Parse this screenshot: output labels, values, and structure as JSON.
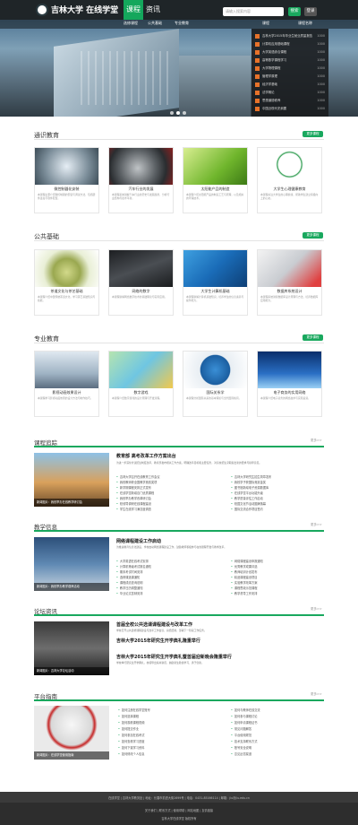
{
  "header": {
    "logo_text": "吉林大学 在线学堂",
    "tabs": [
      "课程",
      "资讯"
    ],
    "search_placeholder": "请输入搜索内容",
    "search_btn": "搜索",
    "login_btn": "登录"
  },
  "hero": {
    "subnav": [
      "选修课程",
      "公共基础",
      "专业教育",
      "课程",
      "课程名称"
    ],
    "popup_items": [
      {
        "label": "吉林大学2015年毕业生就业质量报告",
        "count": "1000"
      },
      {
        "label": "计算机应用基础课程",
        "count": "1000"
      },
      {
        "label": "大学英语综合课程",
        "count": "1000"
      },
      {
        "label": "高等数学课程学习",
        "count": "1000"
      },
      {
        "label": "大学物理课程",
        "count": "1000"
      },
      {
        "label": "管理学原理",
        "count": "1000"
      },
      {
        "label": "经济学基础",
        "count": "1000"
      },
      {
        "label": "法学概论",
        "count": "1000"
      },
      {
        "label": "思想道德修养",
        "count": "1000"
      },
      {
        "label": "中国近现代史纲要",
        "count": "1000"
      }
    ]
  },
  "sections": [
    {
      "title": "通识教育",
      "more": "更多课程",
      "cards": [
        {
          "title": "微控制器化安装",
          "desc": "本课程主要介绍微控制器的安装与调试方法，包括硬件连接与软件配置。"
        },
        {
          "title": "汽车行业的发展",
          "desc": "本课程系统讲解汽车行业的历史与发展趋势，分析行业结构与技术革新。"
        },
        {
          "title": "太阳能产品的制造",
          "desc": "本课程介绍太阳能产品的制造工艺与原理，以及相关的环保技术。"
        },
        {
          "title": "大学生心理健康教育",
          "desc": "本课程关注大学生的心理健康，帮助学生建立积极向上的心态。"
        }
      ]
    },
    {
      "title": "公共基础",
      "more": "更多课程",
      "cards": [
        {
          "title": "茶道文化与茶艺基础",
          "desc": "本课程介绍中国传统茶道文化，学习茶艺基础知识与技能。"
        },
        {
          "title": "网络的数字",
          "desc": "本课程讲解网络数字技术的基础理论与实际应用。"
        },
        {
          "title": "大学生计算机基础",
          "desc": "本课程讲解计算机基础知识，培养学生的信息素养与操作能力。"
        },
        {
          "title": "数据库系统设计",
          "desc": "本课程系统讲授数据库设计原理与方法，培养数据库应用能力。"
        }
      ]
    },
    {
      "title": "专业教育",
      "more": "更多课程",
      "cards": [
        {
          "title": "影视动画效果设计",
          "desc": "本课程学习影视动画效果的设计方法与制作技巧。"
        },
        {
          "title": "数字游戏",
          "desc": "本课程介绍数字游戏的设计原理与开发流程。"
        },
        {
          "title": "国际关系学",
          "desc": "本课程分析国际关系的基本理论与当代国际格局。"
        },
        {
          "title": "电子商务的实用网络",
          "desc": "本课程介绍电子商务的网络技术与实际运营。"
        }
      ]
    }
  ],
  "news": [
    {
      "title": "课程追踪",
      "more": "更多>>",
      "caption": "新闻图片：我校举办在线教学研讨会",
      "headline": "教育部 高考改革工作方案出台",
      "summary": "为进一步深化考试招生制度改革，教育部发布相关工作方案，明确改革目标和主要任务，对高校招生录取提出新的要求与指导意见。",
      "left_items": [
        "吉林大学召开在线教育工作会议",
        "我校教师获全国教学竞赛奖项",
        "新学期课程安排正式发布",
        "在线学堂新增百门优质课程",
        "我校举办教学改革研讨会",
        "校领导调研在线课程建设",
        "学生在线学习满意度调查"
      ],
      "right_items": [
        "吉林大学研究生招生简章发布",
        "我校学子获国际竞赛金奖",
        "图书馆新增电子资源数据库",
        "在线学堂平台功能升级",
        "教学质量评估工作启动",
        "校园文化节活动圆满落幕",
        "国际交流合作项目签约"
      ]
    },
    {
      "title": "教学信息",
      "more": "更多>>",
      "caption": "新闻图片：我校举办教学观摩活动",
      "headline": "网络课程建设工作启动",
      "summary": "为推进教育信息化建设，学校启动网络课程建设工作，鼓励教师积极参与在线课程开发与教学改革。",
      "left_items": [
        "大学英语在线考试安排",
        "计算机等级考试报名通知",
        "期末考试时间安排",
        "选修课选课通知",
        "课程成绩查询说明",
        "教学日历调整通知",
        "毕业论文答辩安排"
      ],
      "right_items": [
        "网络课程建设申报通知",
        "优秀教学成果评选",
        "教师培训计划发布",
        "精品课程建设项目",
        "实验教学改革方案",
        "课程思政示范课程",
        "教学督导工作安排"
      ]
    },
    {
      "title": "论坛资讯",
      "more": "更多>>",
      "caption": "新闻图片：吉林大学论坛活动",
      "headline": "首届全校公共选课课程建设与改革工作",
      "headline2": "吉林大学2015年研究生开学典礼隆重举行",
      "headline3": "吉林大学2015年研究生开学典礼暨首届迎新晚会隆重举行",
      "summary": "学校召开公共选修课程建设与改革工作会议，总结经验，部署下一阶段工作任务。",
      "summary2": "学校举行研究生开学典礼，校领导出席并讲话，勉励新生勤奋学习、勇于创新。",
      "left_items": [],
      "right_items": []
    },
    {
      "title": "平台指南",
      "more": "更多>>",
      "caption": "新闻图片：在线学堂使用指南",
      "headline": "",
      "summary": "",
      "left_items": [
        "如何注册在线学堂账号",
        "如何选择课程",
        "如何观看课程视频",
        "如何提交作业",
        "如何参加在线考试",
        "如何查看学习进度",
        "如何下载学习资料",
        "如何修改个人信息"
      ],
      "right_items": [
        "如何与教师在线交流",
        "如何参与课程讨论",
        "如何申请课程证书",
        "常见问题解答",
        "平台使用规范",
        "技术支持联系方式",
        "账号安全说明",
        "意见反馈渠道"
      ]
    }
  ],
  "footer": {
    "line1": "在线学堂 | 吉林大学教务处 | 地址：长春市前进大街2699号 | 电话：0431-85166114 | 邮箱：jlu@jlu.edu.cn",
    "line2": "关于我们 | 联系方式 | 使用帮助 | 网站地图 | 友情链接",
    "line3": "吉林大学在线学堂 版权所有"
  }
}
